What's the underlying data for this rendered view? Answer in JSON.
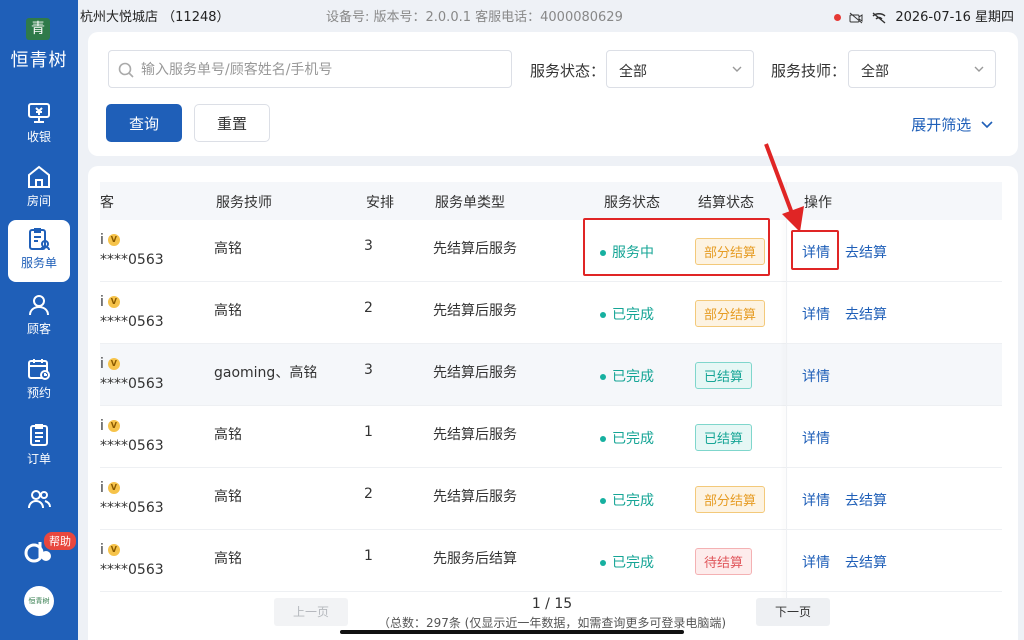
{
  "sidebar": {
    "brand": "恒青树",
    "logo_mark": "青",
    "items": [
      {
        "label": "收银",
        "icon": "cashier-icon"
      },
      {
        "label": "房间",
        "icon": "home-icon"
      },
      {
        "label": "服务单",
        "icon": "service-order-icon"
      },
      {
        "label": "顾客",
        "icon": "user-icon"
      },
      {
        "label": "预约",
        "icon": "calendar-icon"
      },
      {
        "label": "订单",
        "icon": "order-icon"
      },
      {
        "label": "",
        "icon": "staff-icon"
      }
    ],
    "active_index": 2,
    "help_label": "帮助",
    "avatar_text": "恒青树"
  },
  "statusbar": {
    "store_name": "杭州大悦城店",
    "store_id": "（11248）",
    "device_info": "设备号:  版本号：2.0.0.1  客服电话：4000080629",
    "datetime": "2026-07-16 星期四"
  },
  "filters": {
    "search_placeholder": "输入服务单号/顾客姓名/手机号",
    "status_label": "服务状态：",
    "status_value": "全部",
    "tech_label": "服务技师：",
    "tech_value": "全部",
    "query_btn": "查询",
    "reset_btn": "重置",
    "expand_label": "展开筛选"
  },
  "table": {
    "headers": {
      "customer": "客",
      "tech": "服务技师",
      "arrange": "安排",
      "type": "服务单类型",
      "service_status": "服务状态",
      "settle_status": "结算状态",
      "ops": "操作"
    },
    "rows": [
      {
        "name": "i",
        "phone": "****0563",
        "tech": "高铭",
        "arrange": "3",
        "type": "先结算后服务",
        "service_status": "服务中",
        "settle_status": "部分结算",
        "settle_kind": "orange",
        "op_detail": "详情",
        "op_settle": "去结算"
      },
      {
        "name": "i",
        "phone": "****0563",
        "tech": "高铭",
        "arrange": "2",
        "type": "先结算后服务",
        "service_status": "已完成",
        "settle_status": "部分结算",
        "settle_kind": "orange",
        "op_detail": "详情",
        "op_settle": "去结算"
      },
      {
        "name": "i",
        "phone": "****0563",
        "tech": "gaoming、高铭",
        "arrange": "3",
        "type": "先结算后服务",
        "service_status": "已完成",
        "settle_status": "已结算",
        "settle_kind": "green",
        "op_detail": "详情",
        "op_settle": ""
      },
      {
        "name": "i",
        "phone": "****0563",
        "tech": "高铭",
        "arrange": "1",
        "type": "先结算后服务",
        "service_status": "已完成",
        "settle_status": "已结算",
        "settle_kind": "green",
        "op_detail": "详情",
        "op_settle": ""
      },
      {
        "name": "i",
        "phone": "****0563",
        "tech": "高铭",
        "arrange": "2",
        "type": "先结算后服务",
        "service_status": "已完成",
        "settle_status": "部分结算",
        "settle_kind": "orange",
        "op_detail": "详情",
        "op_settle": "去结算"
      },
      {
        "name": "i",
        "phone": "****0563",
        "tech": "高铭",
        "arrange": "1",
        "type": "先服务后结算",
        "service_status": "已完成",
        "settle_status": "待结算",
        "settle_kind": "red",
        "op_detail": "详情",
        "op_settle": "去结算"
      }
    ],
    "vip_mark": "V"
  },
  "pagination": {
    "prev": "上一页",
    "next": "下一页",
    "page": "1 / 15",
    "total": "（总数：297条 (仅显示近一年数据，如需查询更多可登录电脑端)"
  },
  "colors": {
    "primary": "#1f5fb8",
    "annotation": "#e02525"
  }
}
